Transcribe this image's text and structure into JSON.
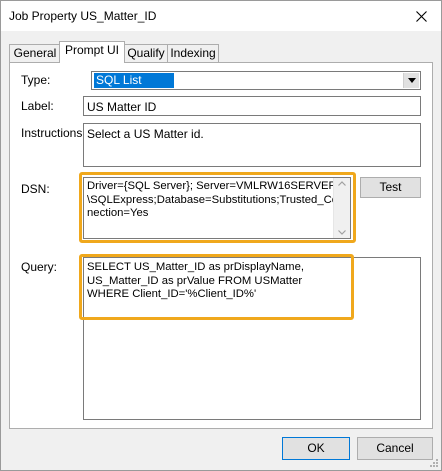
{
  "window": {
    "title": "Job Property US_Matter_ID"
  },
  "tabs": [
    {
      "label": "General"
    },
    {
      "label": "Prompt UI"
    },
    {
      "label": "Qualify"
    },
    {
      "label": "Indexing"
    }
  ],
  "form": {
    "type_label": "Type:",
    "type_value": "SQL List",
    "label_label": "Label:",
    "label_value": "US Matter ID",
    "instructions_label": "Instructions:",
    "instructions_value": "Select a US Matter id.",
    "dsn_label": "DSN:",
    "dsn_value": "Driver={SQL Server}; Server=VMLRW16SERVER\n\\SQLExpress;Database=Substitutions;Trusted_Con\nnection=Yes",
    "test_label": "Test",
    "query_label": "Query:",
    "query_value": "SELECT US_Matter_ID as prDisplayName,\nUS_Matter_ID as prValue FROM USMatter\nWHERE Client_ID='%Client_ID%'"
  },
  "buttons": {
    "ok": "OK",
    "cancel": "Cancel"
  },
  "colors": {
    "highlight": "#f0a81c",
    "selection": "#0078d7"
  }
}
